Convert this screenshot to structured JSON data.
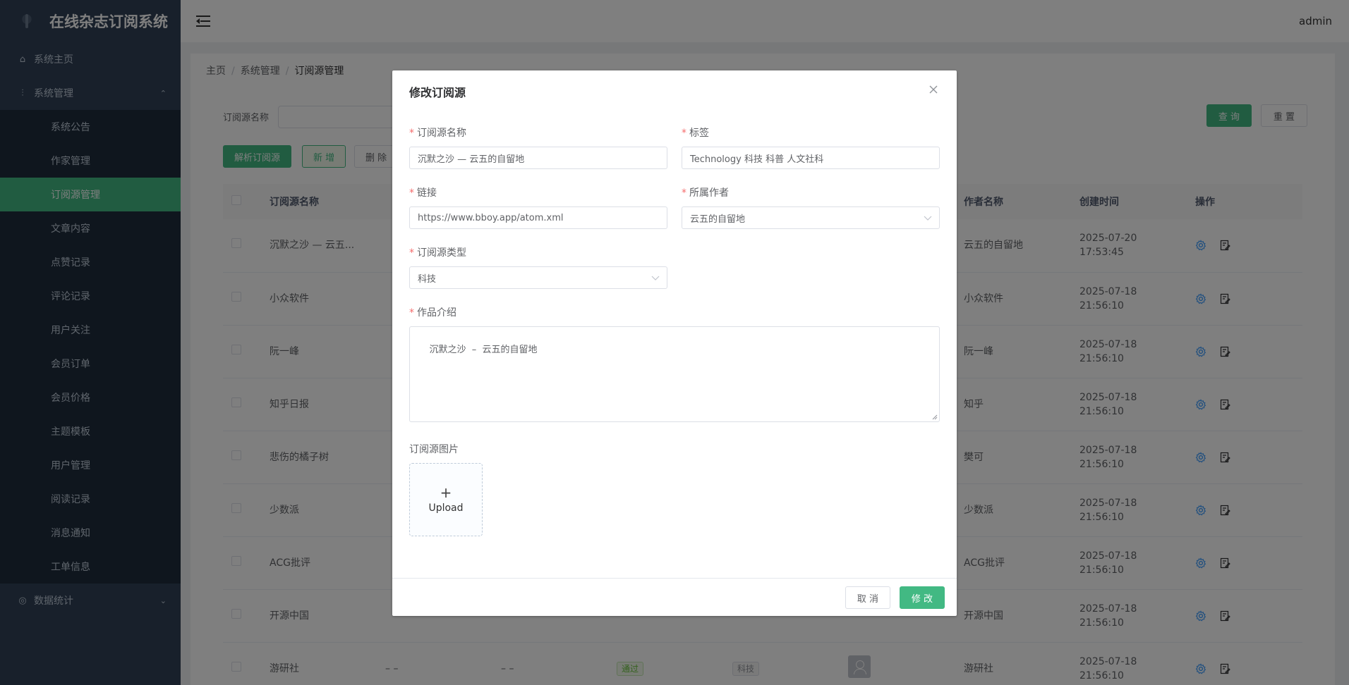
{
  "app": {
    "title": "在线杂志订阅系统",
    "user": "admin"
  },
  "sidebar": {
    "home": "系统主页",
    "system_group": "系统管理",
    "items": [
      "系统公告",
      "作家管理",
      "订阅源管理",
      "文章内容",
      "点赞记录",
      "评论记录",
      "用户关注",
      "会员订单",
      "会员价格",
      "主题模板",
      "用户管理",
      "阅读记录",
      "消息通知",
      "工单信息"
    ],
    "active": "订阅源管理",
    "stats_group": "数据统计"
  },
  "breadcrumb": [
    "主页",
    "系统管理",
    "订阅源管理"
  ],
  "search": {
    "label": "订阅源名称",
    "query": "查 询",
    "reset": "重 置"
  },
  "toolbar": {
    "parse": "解析订阅源",
    "add": "新 增",
    "delete": "删 除"
  },
  "table": {
    "headers": [
      "订阅源名称",
      "作者名称",
      "创建时间",
      "操作"
    ],
    "rows": [
      {
        "name": "沉默之沙 — 云五...",
        "author": "云五的自留地",
        "date": "2025-07-20",
        "time": "17:53:45"
      },
      {
        "name": "小众软件",
        "author": "小众软件",
        "date": "2025-07-18",
        "time": "21:56:10"
      },
      {
        "name": "阮一峰",
        "author": "阮一峰",
        "date": "2025-07-18",
        "time": "21:56:10"
      },
      {
        "name": "知乎日报",
        "author": "知乎",
        "date": "2025-07-18",
        "time": "21:56:10"
      },
      {
        "name": "悲伤的橘子树",
        "author": "樊可",
        "date": "2025-07-18",
        "time": "21:56:10"
      },
      {
        "name": "少数派",
        "author": "少数派",
        "date": "2025-07-18",
        "time": "21:56:10"
      },
      {
        "name": "ACG批评",
        "author": "ACG批评",
        "date": "2025-07-18",
        "time": "21:56:10"
      },
      {
        "name": "开源中国",
        "author": "开源中国",
        "date": "2025-07-18",
        "time": "21:56:10"
      },
      {
        "name": "游研社",
        "author": "游研社",
        "date": "2025-07-18",
        "time": "21:56:10",
        "dash1": "– –",
        "dash2": "– –",
        "status": "通过",
        "category": "科技"
      }
    ]
  },
  "dialog": {
    "title": "修改订阅源",
    "fields": {
      "name_label": "订阅源名称",
      "name_value": "沉默之沙 — 云五的自留地",
      "tags_label": "标签",
      "tags_value": "Technology 科技 科普 人文社科",
      "link_label": "链接",
      "link_value": "https://www.bboy.app/atom.xml",
      "author_label": "所属作者",
      "author_value": "云五的自留地",
      "type_label": "订阅源类型",
      "type_value": "科技",
      "intro_label": "作品介绍",
      "intro_value": "沉默之沙  –  云五的自留地",
      "image_label": "订阅源图片",
      "upload_text": "Upload"
    },
    "cancel": "取 消",
    "submit": "修 改"
  },
  "colors": {
    "primary": "#42b983",
    "sidebar": "#304156",
    "danger": "#f56c6c"
  }
}
